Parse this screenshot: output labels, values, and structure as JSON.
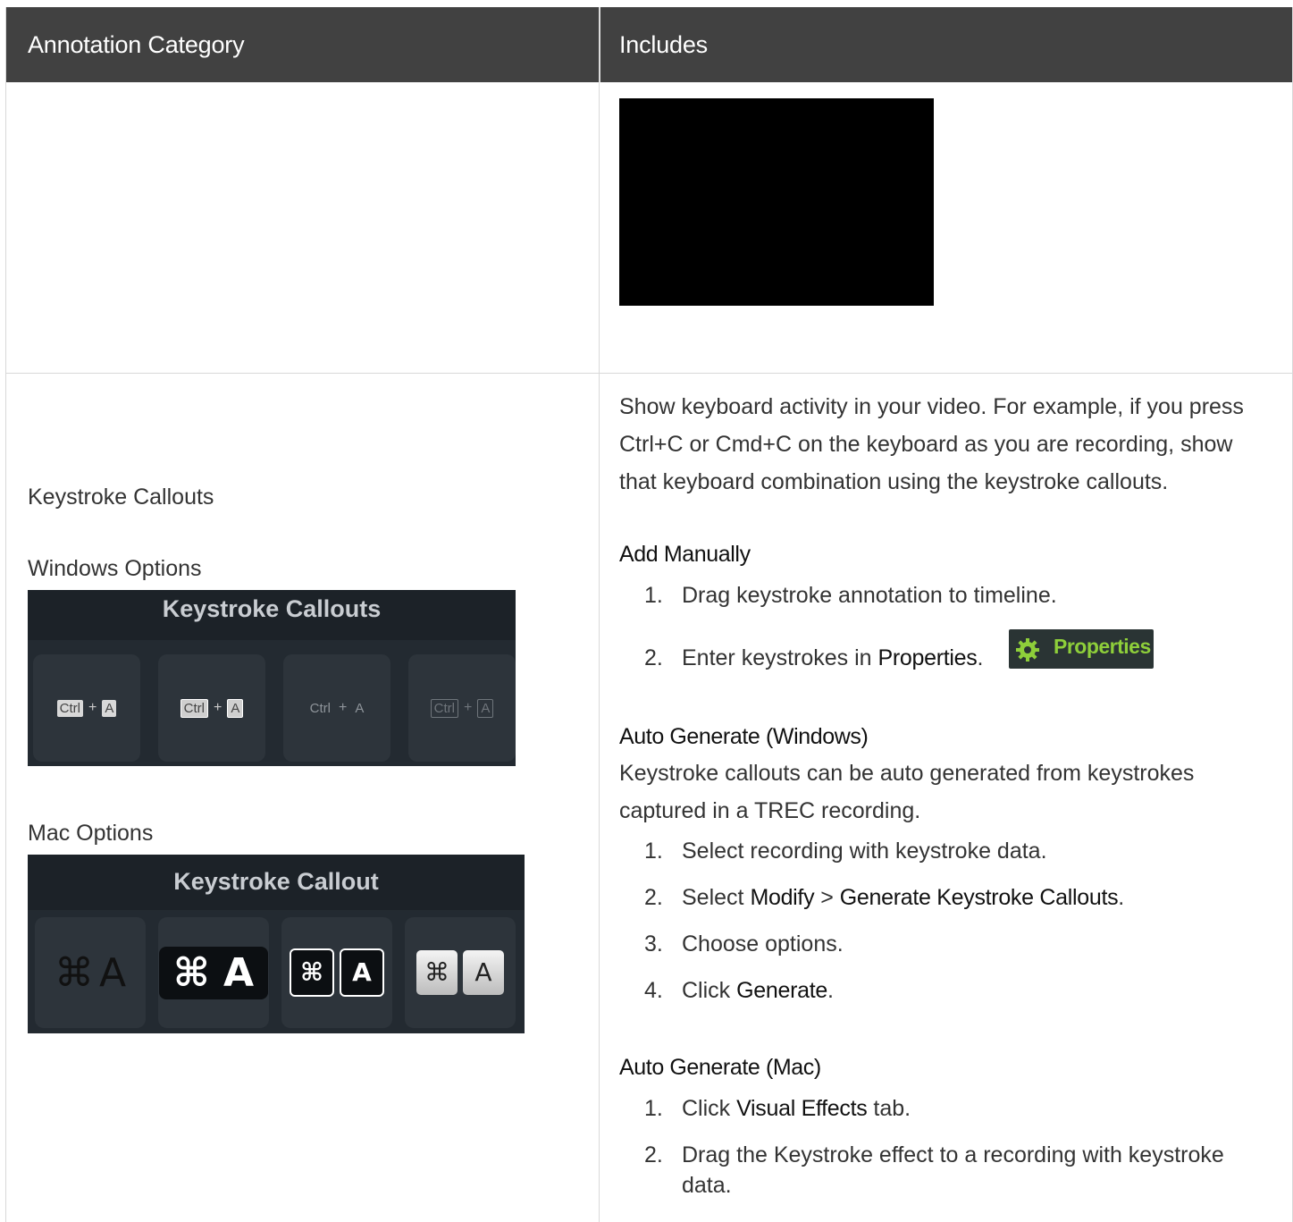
{
  "header": {
    "col1": "Annotation Category",
    "col2": "Includes"
  },
  "left": {
    "category": "Keystroke Callouts",
    "windows_label": "Windows Options",
    "mac_label": "Mac Options",
    "windows_panel": {
      "title": "Keystroke Callouts",
      "keys": [
        "Ctrl",
        "+",
        "A"
      ]
    },
    "mac_panel": {
      "title": "Keystroke Callout",
      "cmd": "⌘",
      "key": "A"
    }
  },
  "right": {
    "intro": "Show keyboard activity in your video. For example, if you press Ctrl+C or Cmd+C on the keyboard as you are recording, show that keyboard combination using the keystroke callouts.",
    "add_manually": {
      "heading": "Add Manually",
      "steps": [
        {
          "num": "1.",
          "text": "Drag keystroke annotation to timeline."
        },
        {
          "num": "2.",
          "pre": "Enter keystrokes in ",
          "bold": "Properties",
          "post": "."
        }
      ],
      "properties_button": "Properties"
    },
    "auto_windows": {
      "heading": "Auto Generate (Windows)",
      "desc": "Keystroke callouts can be auto generated from keystrokes captured in a TREC recording.",
      "steps": [
        {
          "num": "1.",
          "text": "Select recording with keystroke data."
        },
        {
          "num": "2.",
          "pre": "Select ",
          "bold": "Modify",
          "mid": " > ",
          "bold2": "Generate Keystroke Callouts",
          "post": "."
        },
        {
          "num": "3.",
          "text": "Choose options."
        },
        {
          "num": "4.",
          "pre": "Click ",
          "bold": "Generate",
          "post": "."
        }
      ]
    },
    "auto_mac": {
      "heading": "Auto Generate (Mac)",
      "steps": [
        {
          "num": "1.",
          "pre": "Click ",
          "bold": "Visual Effects",
          "post": " tab."
        },
        {
          "num": "2.",
          "line1": "Drag the Keystroke effect to a recording with keystroke",
          "line2": "data."
        }
      ]
    }
  }
}
